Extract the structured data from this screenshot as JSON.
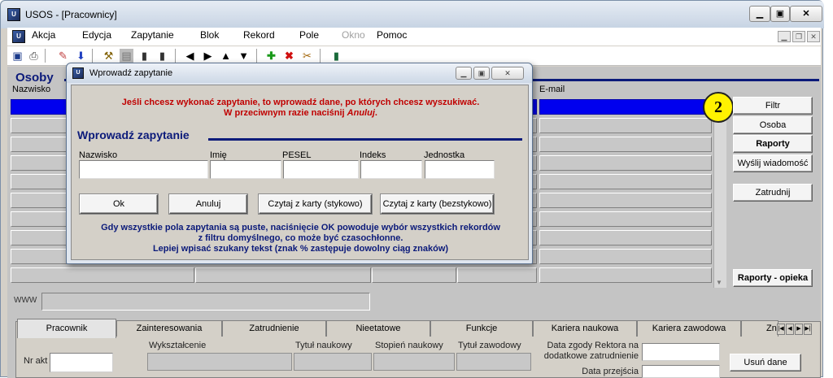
{
  "window": {
    "title": "USOS - [Pracownicy]",
    "app_icon": "app-icon",
    "controls": [
      "minimize-icon",
      "maximize-icon",
      "close-icon"
    ]
  },
  "menubar": {
    "items": [
      "Akcja",
      "Edycja",
      "Zapytanie",
      "Blok",
      "Rekord",
      "Pole",
      "Okno",
      "Pomoc"
    ],
    "disabled": [
      "Okno"
    ]
  },
  "toolbar": {
    "icons": [
      "save-icon",
      "print-icon",
      "edit-icon",
      "download-icon",
      "query-icon",
      "filter-icon",
      "chart-icon",
      "chart2-icon",
      "prev-icon",
      "next-icon",
      "up-icon",
      "down-icon",
      "add-icon",
      "delete-icon",
      "clear-icon",
      "exit-icon"
    ]
  },
  "main": {
    "section_title": "Osoby",
    "columns": [
      "Nazwisko",
      "E-mail"
    ],
    "badge": "2",
    "side_buttons": {
      "filtr": "Filtr",
      "osoba": "Osoba",
      "raporty": "Raporty",
      "wyslij": "Wyślij wiadomość",
      "zatrudnij": "Zatrudnij",
      "raporty_opieka": "Raporty - opieka"
    },
    "www_label": "WWW"
  },
  "tabs": {
    "items": [
      "Pracownik",
      "Zainteresowania",
      "Zatrudnienie",
      "Nieetatowe",
      "Funkcje",
      "Kariera naukowa",
      "Kariera zawodowa",
      "Zn"
    ],
    "active": "Pracownik"
  },
  "form": {
    "nr_akt": "Nr akt",
    "wyksztalcenie": "Wykształcenie",
    "tytul_naukowy": "Tytuł naukowy",
    "stopien_naukowy": "Stopień naukowy",
    "tytul_zawodowy": "Tytuł zawodowy",
    "data_zgody_1": "Data zgody Rektora na",
    "data_zgody_2": "dodatkowe zatrudnienie",
    "data_przejscia": "Data przejścia",
    "usun_dane": "Usuń dane"
  },
  "dialog": {
    "title": "Wprowadź zapytanie",
    "info_line1": "Jeśli chcesz wykonać zapytanie, to wprowadź dane, po których chcesz wyszukiwać.",
    "info_line2_prefix": "W przeciwnym razie naciśnij ",
    "info_line2_em": "Anuluj",
    "info_line2_suffix": ".",
    "heading": "Wprowadź zapytanie",
    "fields": {
      "nazwisko": {
        "label": "Nazwisko",
        "value": ""
      },
      "imie": {
        "label": "Imię",
        "value": ""
      },
      "pesel": {
        "label": "PESEL",
        "value": ""
      },
      "indeks": {
        "label": "Indeks",
        "value": ""
      },
      "jednostka": {
        "label": "Jednostka",
        "value": ""
      }
    },
    "buttons": {
      "ok": "Ok",
      "anuluj": "Anuluj",
      "czytaj_stykowo": "Czytaj z karty (stykowo)",
      "czytaj_bezstykowo": "Czytaj z karty (bezstykowo)"
    },
    "note_line1": "Gdy wszystkie pola zapytania są puste, naciśnięcie OK powoduje wybór wszystkich rekordów",
    "note_line2": "z filtru domyślnego,  co może być czasochłonne.",
    "note_line3": "Lepiej wpisać szukany tekst (znak % zastępuje dowolny ciąg znaków)"
  }
}
